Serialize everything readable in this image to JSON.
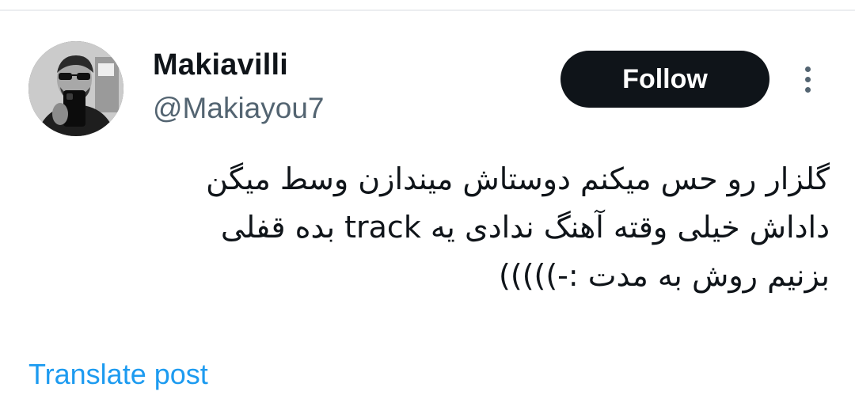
{
  "author": {
    "display_name": "Makiavilli",
    "handle": "@Makiayou7",
    "avatar_icon": "user-avatar-photo"
  },
  "actions": {
    "follow_label": "Follow",
    "more_icon": "more-vertical-icon"
  },
  "post": {
    "lines": [
      "گلزار رو حس میکنم دوستاش میندازن وسط میگن",
      "داداش خیلی وقته آهنگ ندادی یه track  بده قفلی",
      "بزنیم روش به مدت :-)))))"
    ]
  },
  "footer": {
    "translate_label": "Translate post"
  },
  "colors": {
    "text_primary": "#0f1419",
    "text_secondary": "#536471",
    "link": "#1d9bf0",
    "button_bg": "#0f1419",
    "button_text": "#ffffff"
  }
}
